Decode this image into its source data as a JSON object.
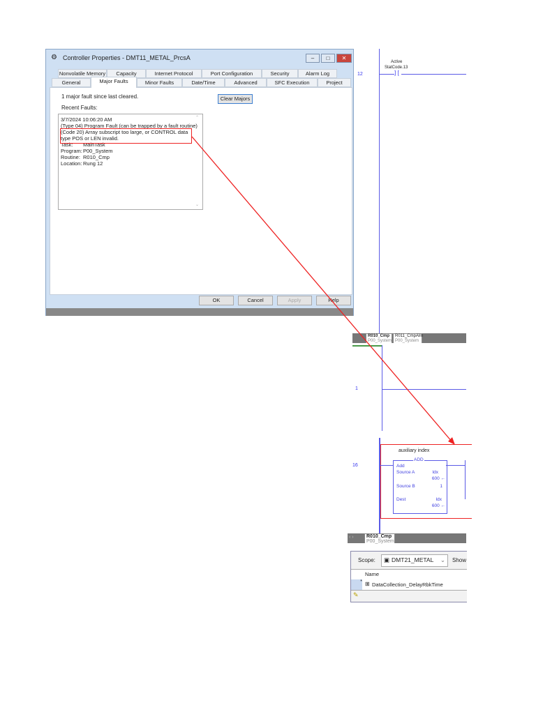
{
  "dialog": {
    "title": "Controller Properties - DMT11_METAL_PrcsA",
    "tabs_row1": [
      "Nonvolatile Memory",
      "Capacity",
      "Internet Protocol",
      "Port Configuration",
      "Security",
      "Alarm Log"
    ],
    "tabs_row2": [
      "General",
      "Major Faults",
      "Minor Faults",
      "Date/Time",
      "Advanced",
      "SFC Execution",
      "Project"
    ],
    "selected_tab": "Major Faults",
    "fault_count_text": "1 major fault since last cleared.",
    "clear_button": "Clear Majors",
    "recent_faults_label": "Recent Faults:",
    "faults": {
      "timestamp": "3/7/2024 10:06:20 AM",
      "type": "(Type 04) Program Fault (can be trapped by a fault routine)",
      "code_line1": "(Code 20) Array subscript too large, or CONTROL data",
      "code_line2": "type POS or LEN invalid.",
      "details": [
        {
          "k": "Task:",
          "v": "MainTask"
        },
        {
          "k": "Program:",
          "v": "P00_System"
        },
        {
          "k": "Routine:",
          "v": "R010_Cmp"
        },
        {
          "k": "Location:",
          "v": "Rung 12"
        }
      ]
    },
    "buttons": {
      "ok": "OK",
      "cancel": "Cancel",
      "apply": "Apply",
      "help": "Help"
    }
  },
  "ladder1": {
    "rung": "12",
    "tag_desc": "Active",
    "tag": "StatCode.13"
  },
  "tabs1": [
    {
      "name": "R010_Cmp",
      "program": "P00_System"
    },
    {
      "name": "R011_CmpAlm",
      "program": "P00_System"
    }
  ],
  "ladder2": {
    "rung": "1"
  },
  "ladder3": {
    "rung": "16",
    "comment": "auxiliary index",
    "instr": "ADD",
    "title": "Add",
    "srcA_label": "Source A",
    "srcA_tag": "Idx",
    "srcA_val": "600 ←",
    "srcB_label": "Source B",
    "srcB_val": "1",
    "dest_label": "Dest",
    "dest_tag": "Idx",
    "dest_val": "600 ←"
  },
  "tabs2": [
    {
      "name": "R010_Cmp",
      "program": "P00_System"
    }
  ],
  "tags": {
    "scope_label": "Scope:",
    "scope_value": "DMT21_METAL",
    "show_label": "Show",
    "col_name": "Name",
    "row": "DataCollection_DelayRbkTime",
    "row_marker": "*"
  },
  "colors": {
    "annotation": "#ee2222",
    "rung": "#5a5ae6"
  }
}
